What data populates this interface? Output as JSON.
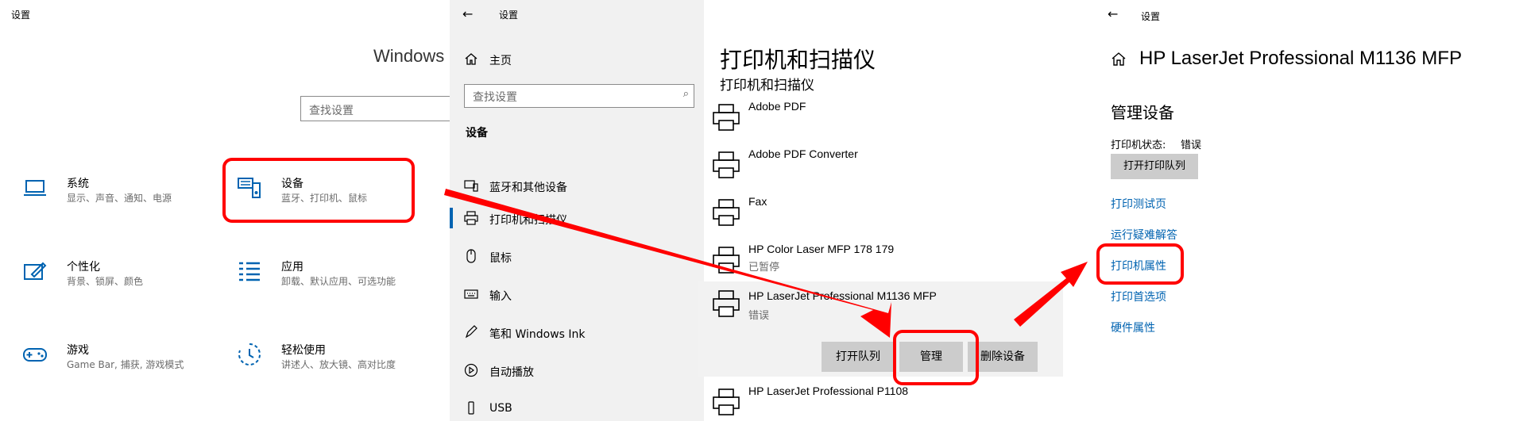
{
  "panel1": {
    "window_title": "设置",
    "windows_heading": "Windows",
    "search_placeholder": "查找设置",
    "categories": [
      {
        "title": "系统",
        "sub": "显示、声音、通知、电源"
      },
      {
        "title": "设备",
        "sub": "蓝牙、打印机、鼠标"
      },
      {
        "title": "个性化",
        "sub": "背景、锁屏、颜色"
      },
      {
        "title": "应用",
        "sub": "卸载、默认应用、可选功能"
      },
      {
        "title": "游戏",
        "sub": "Game Bar, 捕获, 游戏模式"
      },
      {
        "title": "轻松使用",
        "sub": "讲述人、放大镜、高对比度"
      }
    ]
  },
  "panel2": {
    "window_title": "设置",
    "home_label": "主页",
    "search_placeholder": "查找设置",
    "section_title": "设备",
    "nav": [
      {
        "label": "蓝牙和其他设备"
      },
      {
        "label": "打印机和扫描仪"
      },
      {
        "label": "鼠标"
      },
      {
        "label": "输入"
      },
      {
        "label": "笔和 Windows Ink"
      },
      {
        "label": "自动播放"
      },
      {
        "label": "USB"
      }
    ],
    "page_title": "打印机和扫描仪",
    "page_subtitle": "打印机和扫描仪",
    "printers": [
      {
        "name": "Adobe PDF",
        "status": ""
      },
      {
        "name": "Adobe PDF Converter",
        "status": ""
      },
      {
        "name": "Fax",
        "status": ""
      },
      {
        "name": "HP Color Laser MFP 178 179",
        "status": "已暂停"
      },
      {
        "name": "HP LaserJet Professional M1136 MFP",
        "status": "错误"
      },
      {
        "name": "HP LaserJet Professional P1108",
        "status": ""
      }
    ],
    "buttons": {
      "open_queue": "打开队列",
      "manage": "管理",
      "remove": "删除设备"
    }
  },
  "panel3": {
    "window_title": "设置",
    "device_title": "HP LaserJet Professional M1136 MFP",
    "section_title": "管理设备",
    "status_label": "打印机状态:",
    "status_value": "错误",
    "open_queue_button": "打开打印队列",
    "links": [
      "打印测试页",
      "运行疑难解答",
      "打印机属性",
      "打印首选项",
      "硬件属性"
    ]
  },
  "colors": {
    "accent": "#0063b1",
    "annotation": "#ff0000",
    "sidebar_bg": "#f1f1f1",
    "button_bg": "#cccccc"
  }
}
